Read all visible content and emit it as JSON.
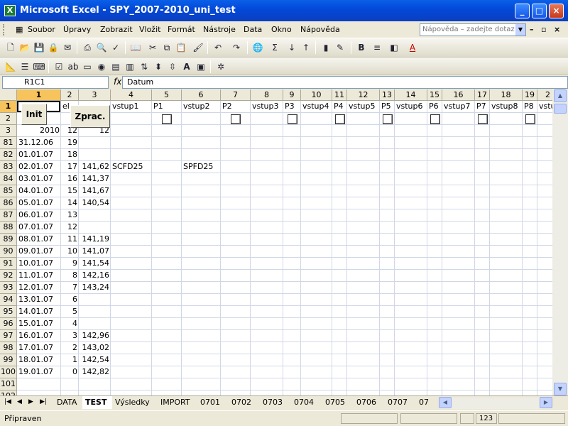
{
  "window": {
    "title": "Microsoft Excel - SPY_2007-2010_uni_test",
    "minimize": "_",
    "maximize": "□",
    "close": "×"
  },
  "menu": {
    "items": [
      "Soubor",
      "Úpravy",
      "Zobrazit",
      "Vložit",
      "Formát",
      "Nástroje",
      "Data",
      "Okno",
      "Nápověda"
    ],
    "help_placeholder": "Nápověda – zadejte dotaz"
  },
  "formula_bar": {
    "name_box": "R1C1",
    "fx": "fx",
    "content": "Datum"
  },
  "columns": [
    "1",
    "2",
    "3",
    "4",
    "5",
    "6",
    "7",
    "8",
    "9",
    "10",
    "11",
    "12",
    "13",
    "14",
    "15",
    "16",
    "17",
    "18",
    "19",
    "2"
  ],
  "row_numbers": [
    "1",
    "2",
    "3",
    "81",
    "82",
    "83",
    "84",
    "85",
    "86",
    "87",
    "88",
    "89",
    "90",
    "91",
    "92",
    "93",
    "94",
    "95",
    "96",
    "97",
    "98",
    "99",
    "100",
    "101",
    "102"
  ],
  "header_row": [
    "",
    "el",
    "",
    "vstup1",
    "P1",
    "vstup2",
    "P2",
    "vstup3",
    "P3",
    "vstup4",
    "P4",
    "vstup5",
    "P5",
    "vstup6",
    "P6",
    "vstup7",
    "P7",
    "vstup8",
    "P8",
    "vstu"
  ],
  "row3": [
    "2010",
    "12",
    "12"
  ],
  "data_rows": [
    [
      "31.12.06",
      "19",
      ""
    ],
    [
      "01.01.07",
      "18",
      ""
    ],
    [
      "02.01.07",
      "17",
      "141,62"
    ],
    [
      "03.01.07",
      "16",
      "141,37"
    ],
    [
      "04.01.07",
      "15",
      "141,67"
    ],
    [
      "05.01.07",
      "14",
      "140,54"
    ],
    [
      "06.01.07",
      "13",
      ""
    ],
    [
      "07.01.07",
      "12",
      ""
    ],
    [
      "08.01.07",
      "11",
      "141,19"
    ],
    [
      "09.01.07",
      "10",
      "141,07"
    ],
    [
      "10.01.07",
      "9",
      "141,54"
    ],
    [
      "11.01.07",
      "8",
      "142,16"
    ],
    [
      "12.01.07",
      "7",
      "143,24"
    ],
    [
      "13.01.07",
      "6",
      ""
    ],
    [
      "14.01.07",
      "5",
      ""
    ],
    [
      "15.01.07",
      "4",
      ""
    ],
    [
      "16.01.07",
      "3",
      "142,96"
    ],
    [
      "17.01.07",
      "2",
      "143,02"
    ],
    [
      "18.01.07",
      "1",
      "142,54"
    ],
    [
      "19.01.07",
      "0",
      "142,82"
    ]
  ],
  "extra_cells": {
    "d83": "SCFD25",
    "f83": "SPFD25"
  },
  "buttons": {
    "init": "Init",
    "zprac": "Zprac."
  },
  "sheet_tabs": [
    "DATA",
    "TEST",
    "Výsledky",
    "IMPORT",
    "0701",
    "0702",
    "0703",
    "0704",
    "0705",
    "0706",
    "0707",
    "07"
  ],
  "active_tab": "TEST",
  "status": {
    "text": "Připraven",
    "num": "123"
  }
}
